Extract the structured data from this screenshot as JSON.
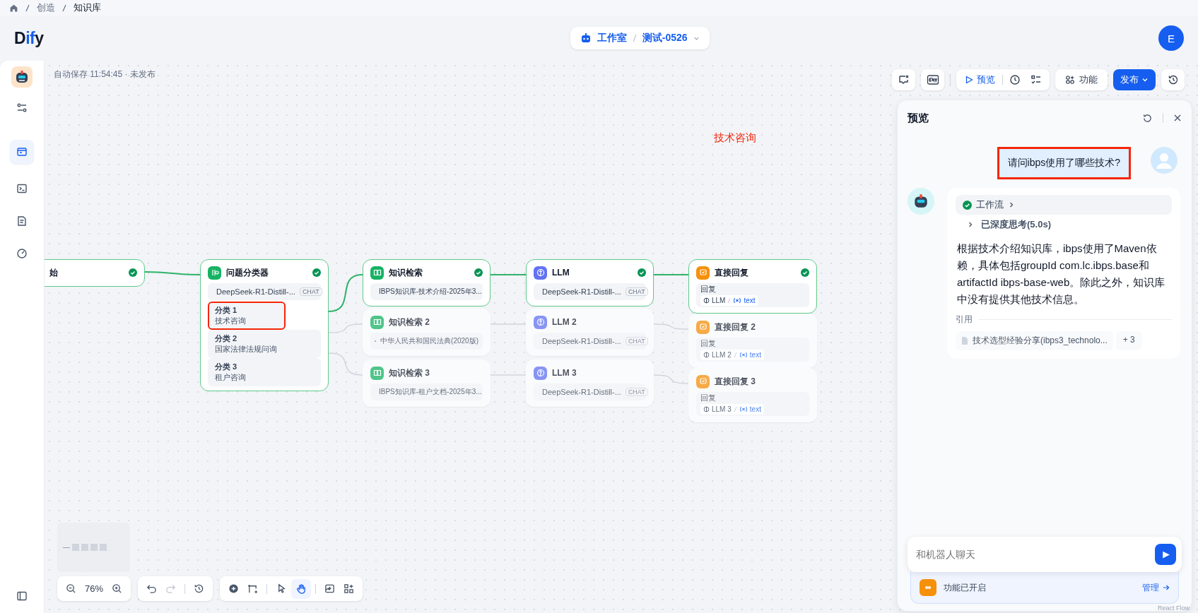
{
  "breadcrumb": [
    "创造",
    "知识库"
  ],
  "header": {
    "logo": [
      {
        "text": "D",
        "accent": false
      },
      {
        "text": "if",
        "accent": true
      },
      {
        "text": "y",
        "accent": false
      }
    ],
    "workspace": "工作室",
    "app_name": "测试-0526",
    "user_initial": "E"
  },
  "sidebar": {
    "items": [
      {
        "kind": "settings",
        "selected": false
      },
      {
        "kind": "orchestrate",
        "selected": true
      },
      {
        "kind": "api",
        "selected": false
      },
      {
        "kind": "logs",
        "selected": false
      },
      {
        "kind": "monitor",
        "selected": false
      }
    ]
  },
  "canvas": {
    "autosave": "自动保存 11:54:45 · 未发布",
    "toolbar": {
      "preview": "预览",
      "features": "功能",
      "publish": "发布"
    },
    "nodes": [
      {
        "kind": "start",
        "title": "始",
        "active": true,
        "done": true
      },
      {
        "kind": "classifier",
        "title": "问题分类器",
        "active": true,
        "done": true,
        "model": "DeepSeek-R1-Distill-...",
        "model_tag": "CHAT",
        "classes": [
          {
            "label": "分类 1",
            "text": "技术咨询",
            "highlighted": true
          },
          {
            "label": "分类 2",
            "text": "国家法律法规问询",
            "highlighted": false
          },
          {
            "label": "分类 3",
            "text": "租户咨询",
            "highlighted": false
          }
        ]
      },
      {
        "kind": "retrieval",
        "title": "知识检索",
        "active": true,
        "done": true,
        "dataset": "IBPS知识库-技术介绍-2025年3..."
      },
      {
        "kind": "retrieval",
        "title": "知识检索 2",
        "active": false,
        "done": false,
        "dataset": "中华人民共和国民法典(2020版)"
      },
      {
        "kind": "retrieval",
        "title": "知识检索 3",
        "active": false,
        "done": false,
        "dataset": "IBPS知识库-租户文档-2025年3..."
      },
      {
        "kind": "llm",
        "title": "LLM",
        "active": true,
        "done": true,
        "model": "DeepSeek-R1-Distill-...",
        "model_tag": "CHAT"
      },
      {
        "kind": "llm",
        "title": "LLM 2",
        "active": false,
        "done": false,
        "model": "DeepSeek-R1-Distill-...",
        "model_tag": "CHAT"
      },
      {
        "kind": "llm",
        "title": "LLM 3",
        "active": false,
        "done": false,
        "model": "DeepSeek-R1-Distill-...",
        "model_tag": "CHAT"
      },
      {
        "kind": "answer",
        "title": "直接回复",
        "active": true,
        "done": true,
        "reply_label": "回复",
        "source": "LLM",
        "variable": "text"
      },
      {
        "kind": "answer",
        "title": "直接回复 2",
        "active": false,
        "done": false,
        "reply_label": "回复",
        "source": "LLM 2",
        "variable": "text"
      },
      {
        "kind": "answer",
        "title": "直接回复 3",
        "active": false,
        "done": false,
        "reply_label": "回复",
        "source": "LLM 3",
        "variable": "text"
      }
    ],
    "annotation": {
      "label": "技术咨询"
    },
    "zoom": "76%",
    "tools": [
      {
        "kind": "pointer",
        "selected": false
      },
      {
        "kind": "hand",
        "selected": true
      }
    ],
    "attribution": "React Flow"
  },
  "preview": {
    "title": "预览",
    "user_message": {
      "text": "请问ibps使用了哪些技术?",
      "highlighted": true
    },
    "answer": {
      "workflow": "工作流",
      "workflow_done": true,
      "thinking": "已深度思考(5.0s)",
      "text": "根据技术介绍知识库，ibps使用了Maven依赖，具体包括groupId com.lc.ibps.base和artifactId ibps-base-web。除此之外，知识库中没有提供其他技术信息。",
      "citation_label": "引用",
      "citation": "技术选型经验分享(ibps3_technolo...",
      "citation_more": "+ 3"
    },
    "input": {
      "placeholder": "和机器人聊天"
    },
    "features": {
      "text": "功能已开启",
      "manage": "管理"
    }
  }
}
